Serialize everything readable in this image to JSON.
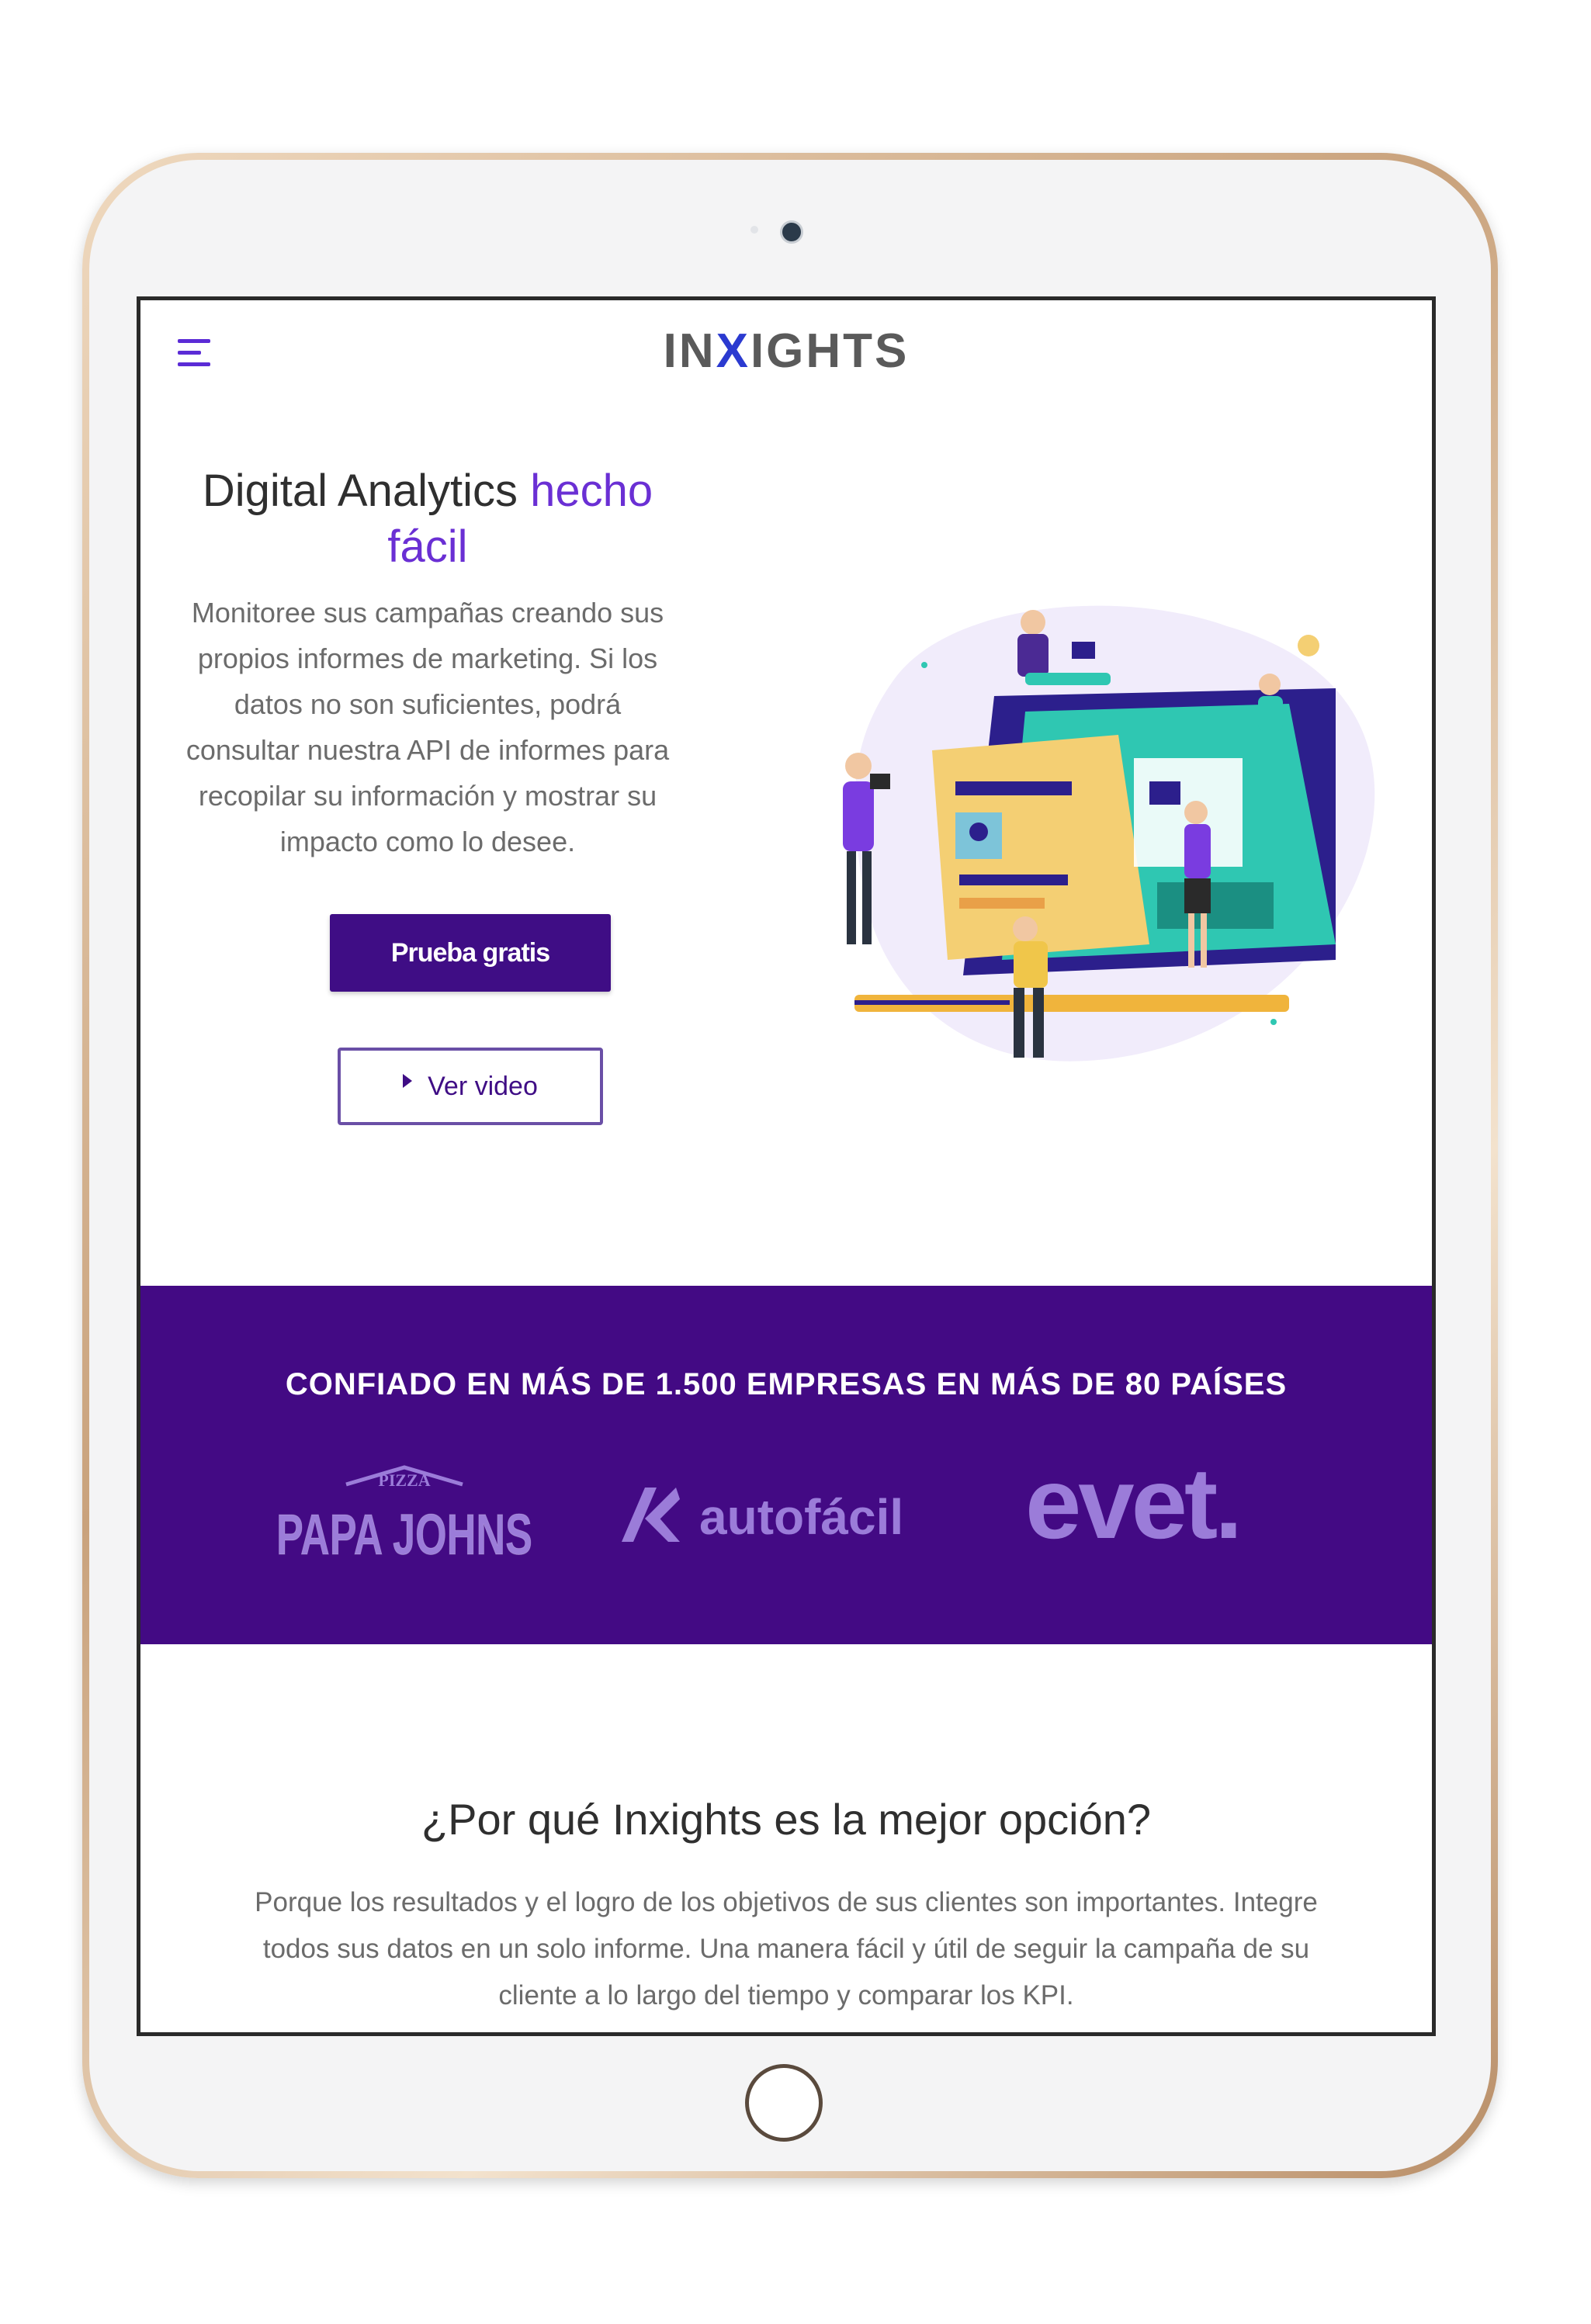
{
  "header": {
    "logo_text_before": "IN",
    "logo_text_accent": "X",
    "logo_text_after": "IGHTS"
  },
  "hero": {
    "title_main": "Digital Analytics ",
    "title_accent": "hecho fácil",
    "description": "Monitoree sus campañas creando sus propios informes de marketing. Si los datos no son suficientes, podrá consultar nuestra API de informes para recopilar su información y mostrar su impacto como lo desee.",
    "primary_button": "Prueba gratis",
    "secondary_button": "Ver video"
  },
  "trust": {
    "title": "CONFIADO EN MÁS DE 1.500 EMPRESAS EN MÁS DE 80 PAÍSES",
    "logos": [
      {
        "name": "PAPA JOHNS",
        "sub": "PIZZA"
      },
      {
        "name": "autofácil"
      },
      {
        "name": "evet."
      }
    ]
  },
  "why": {
    "title": "¿Por qué Inxights es la mejor opción?",
    "description": "Porque los resultados y el logro de los objetivos de sus clientes son importantes. Integre todos sus datos en un solo informe. Una manera fácil y útil de seguir la campaña de su cliente a lo largo del tiempo y comparar los KPI."
  },
  "colors": {
    "brand_purple": "#430a84",
    "accent_purple": "#6a2fd4",
    "logo_tint": "#9b7cd9"
  }
}
